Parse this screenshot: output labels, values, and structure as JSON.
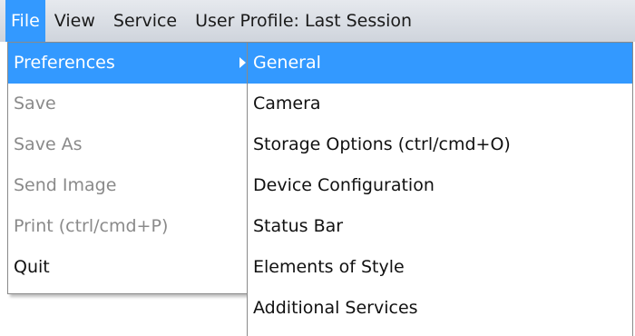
{
  "menubar": {
    "file": "File",
    "view": "View",
    "service": "Service",
    "profile": "User Profile: Last Session"
  },
  "file_menu": {
    "preferences": "Preferences",
    "save": "Save",
    "save_as": "Save As",
    "send_image": "Send Image",
    "print": "Print (ctrl/cmd+P)",
    "quit": "Quit"
  },
  "preferences_submenu": {
    "general": "General",
    "camera": "Camera",
    "storage": "Storage Options (ctrl/cmd+O)",
    "device": "Device Configuration",
    "status_bar": "Status Bar",
    "elements": "Elements of Style",
    "additional": "Additional Services"
  },
  "colors": {
    "highlight": "#3399ff",
    "disabled_text": "#8a8a8a"
  }
}
